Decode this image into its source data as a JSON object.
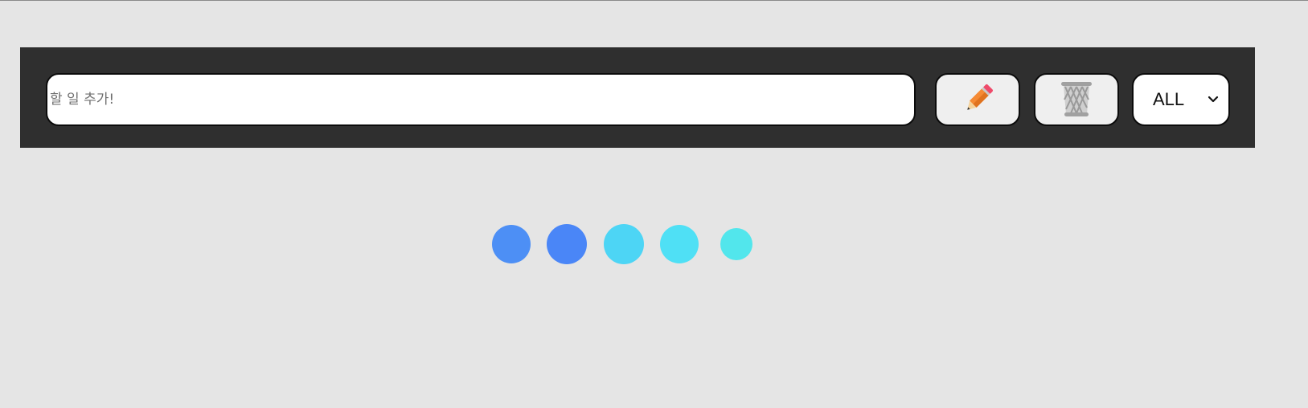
{
  "todo": {
    "input_placeholder": "할 일 추가!",
    "input_value": ""
  },
  "toolbar": {
    "add_icon": "pencil-icon",
    "delete_icon": "trash-can-icon"
  },
  "filter": {
    "selected": "ALL"
  },
  "loader": {
    "dot_colors": [
      "#4d8ff5",
      "#4a86f7",
      "#4dd5f5",
      "#4fe0f5",
      "#52e6ec"
    ]
  },
  "colors": {
    "background": "#e5e5e5",
    "toolbar": "#2f2f2f",
    "pencil_body": "#f58a34",
    "pencil_eraser": "#ef4a6a",
    "trash": "#a9a9a9"
  }
}
